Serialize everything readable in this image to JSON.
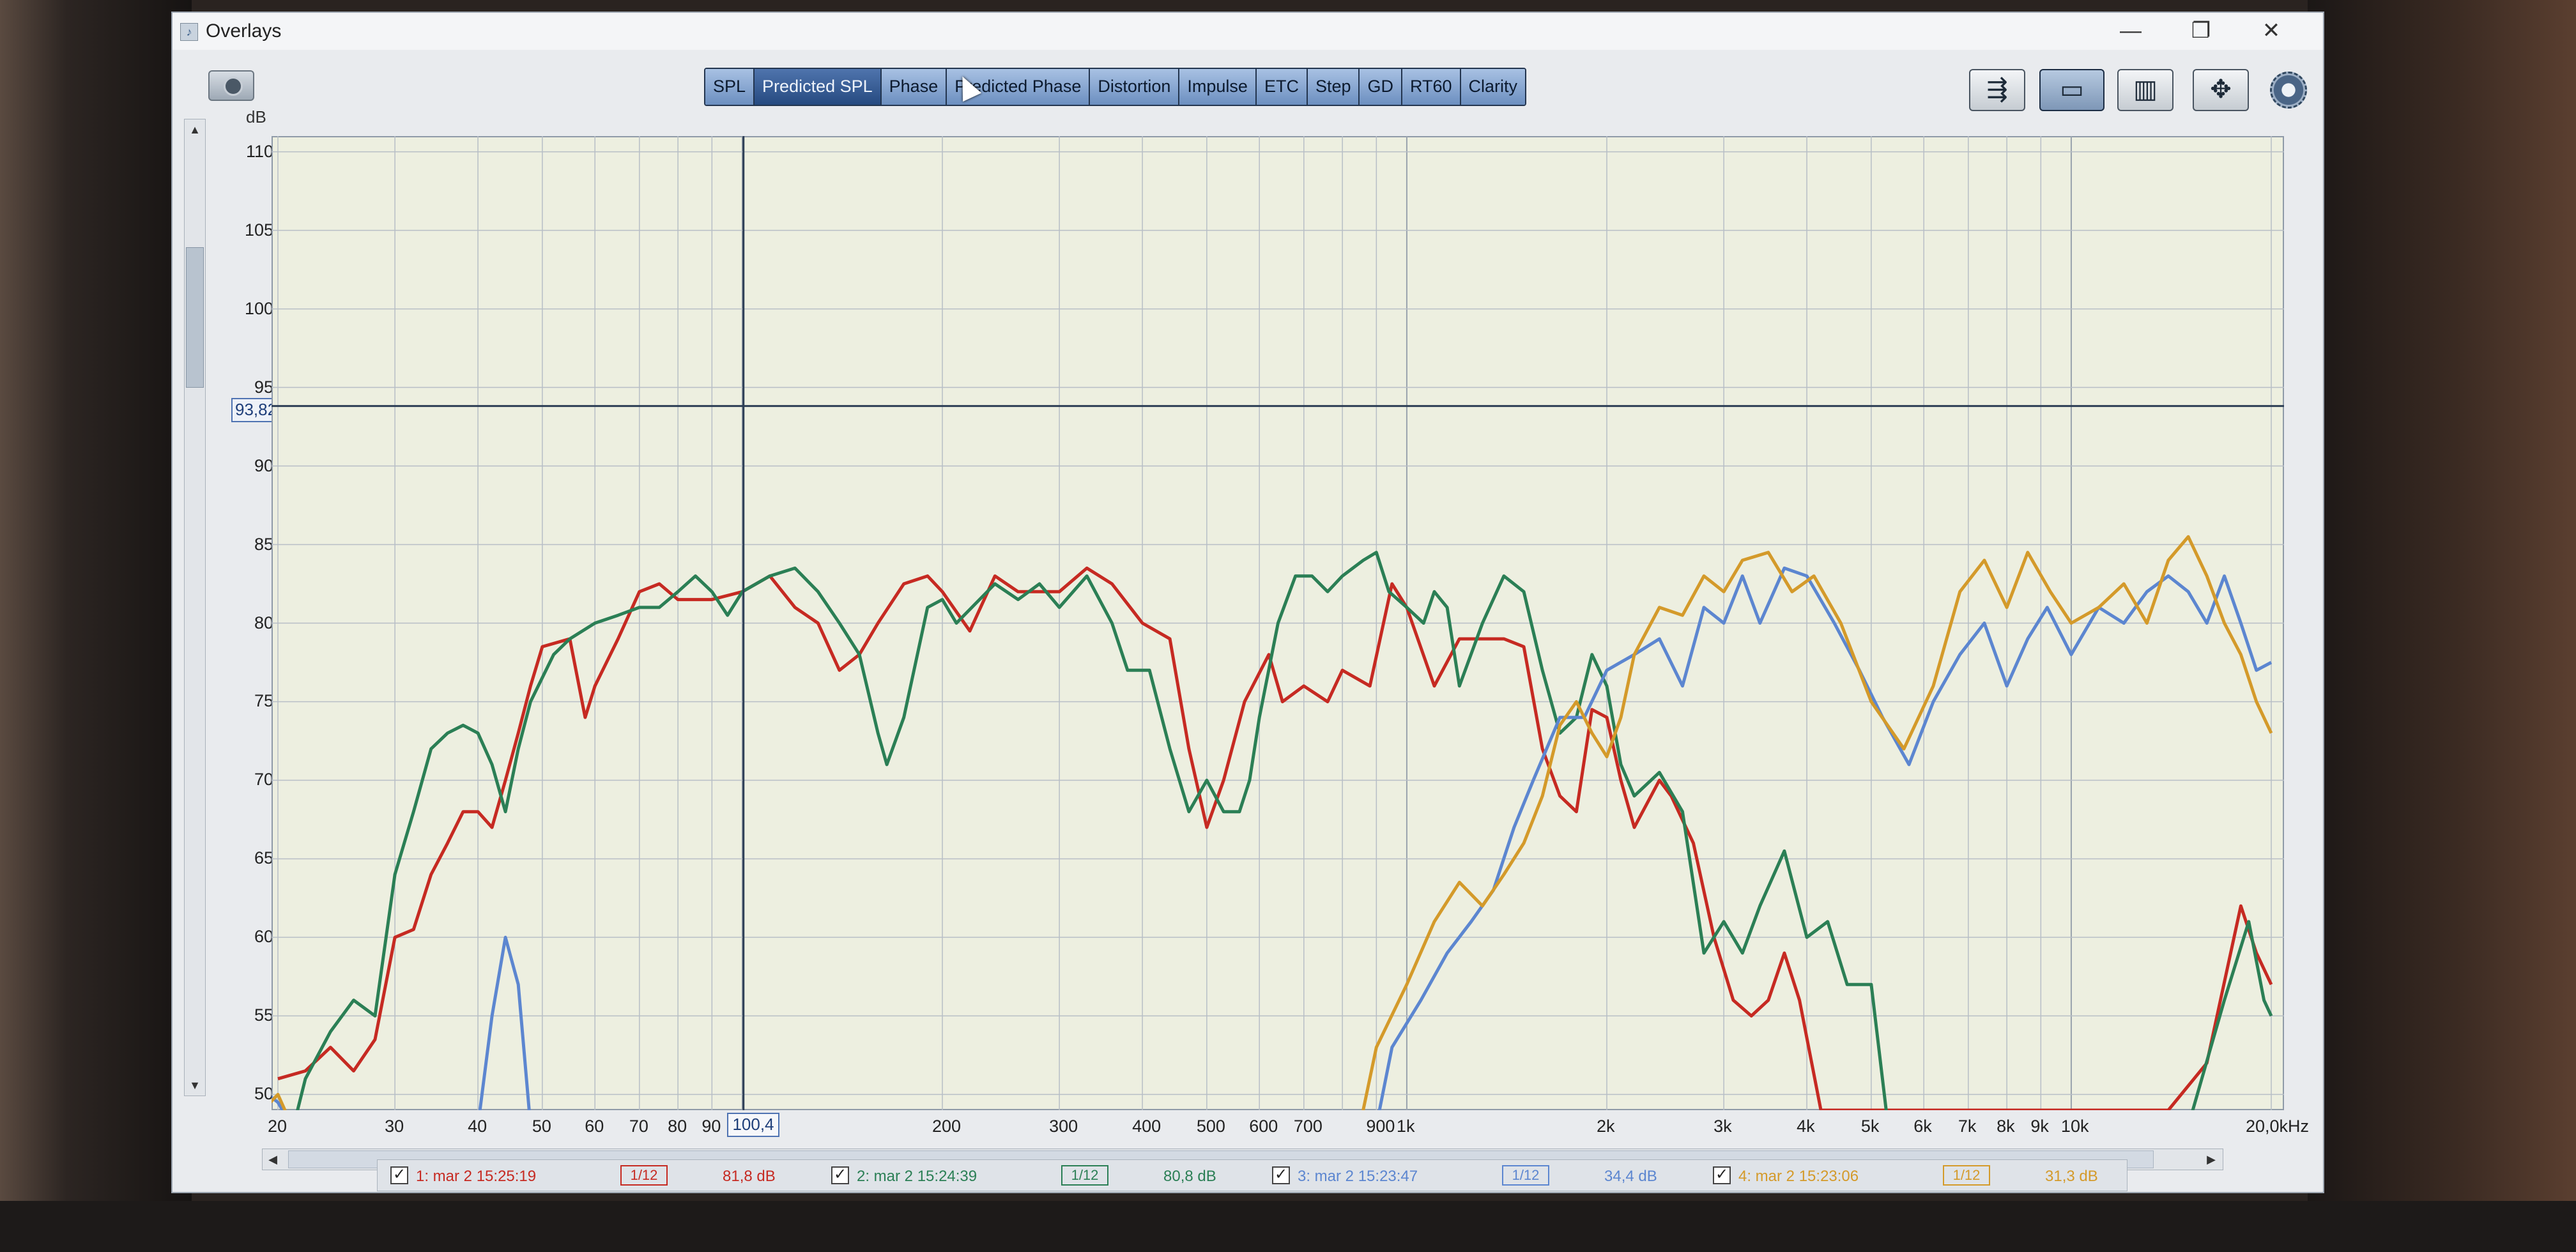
{
  "window": {
    "title": "Overlays",
    "controls": {
      "minimize": "—",
      "restore": "❐",
      "close": "✕"
    }
  },
  "tabs": [
    {
      "label": "SPL",
      "active": false
    },
    {
      "label": "Predicted SPL",
      "active": true
    },
    {
      "label": "Phase",
      "active": false
    },
    {
      "label": "Predicted Phase",
      "active": false
    },
    {
      "label": "Distortion",
      "active": false
    },
    {
      "label": "Impulse",
      "active": false
    },
    {
      "label": "ETC",
      "active": false
    },
    {
      "label": "Step",
      "active": false
    },
    {
      "label": "GD",
      "active": false
    },
    {
      "label": "RT60",
      "active": false
    },
    {
      "label": "Clarity",
      "active": false
    }
  ],
  "toolbar_icons": [
    "traces-icon",
    "zoom-window-icon",
    "grid-toggle-icon",
    "pan-arrows-icon",
    "gear-icon"
  ],
  "y_axis": {
    "unit": "dB",
    "ticks": [
      "110",
      "105",
      "100",
      "95",
      "90",
      "85",
      "80",
      "75",
      "70",
      "65",
      "60",
      "55",
      "50"
    ],
    "cursor_value": "93,82"
  },
  "x_axis": {
    "ticks": [
      "20",
      "30",
      "40",
      "50",
      "60",
      "70",
      "80",
      "90",
      "200",
      "300",
      "400",
      "500",
      "600",
      "700",
      "900",
      "1k",
      "2k",
      "3k",
      "4k",
      "5k",
      "6k",
      "7k",
      "8k",
      "9k",
      "10k",
      "20,0kHz"
    ],
    "cursor_value": "100,4"
  },
  "chart_data": {
    "type": "line",
    "title": "",
    "xlabel": "",
    "ylabel": "dB",
    "x_scale": "log",
    "xlim": [
      20,
      20000
    ],
    "ylim": [
      49,
      111
    ],
    "cursor": {
      "x": 100.4,
      "y": 93.82
    },
    "series": [
      {
        "name": "1: mar 2 15:25:19",
        "color": "#c62a22",
        "points": [
          [
            20,
            51
          ],
          [
            22,
            51.5
          ],
          [
            24,
            53
          ],
          [
            26,
            51.5
          ],
          [
            28,
            53.5
          ],
          [
            30,
            60
          ],
          [
            32,
            60.5
          ],
          [
            34,
            64
          ],
          [
            36,
            66
          ],
          [
            38,
            68
          ],
          [
            40,
            68
          ],
          [
            42,
            67
          ],
          [
            44,
            70
          ],
          [
            46,
            73
          ],
          [
            48,
            76
          ],
          [
            50,
            78.5
          ],
          [
            55,
            79
          ],
          [
            58,
            74
          ],
          [
            60,
            76
          ],
          [
            65,
            79
          ],
          [
            70,
            82
          ],
          [
            75,
            82.5
          ],
          [
            80,
            81.5
          ],
          [
            90,
            81.5
          ],
          [
            100,
            82
          ],
          [
            110,
            83
          ],
          [
            120,
            81
          ],
          [
            130,
            80
          ],
          [
            140,
            77
          ],
          [
            150,
            78
          ],
          [
            160,
            80
          ],
          [
            175,
            82.5
          ],
          [
            190,
            83
          ],
          [
            200,
            82
          ],
          [
            220,
            79.5
          ],
          [
            240,
            83
          ],
          [
            260,
            82
          ],
          [
            300,
            82
          ],
          [
            330,
            83.5
          ],
          [
            360,
            82.5
          ],
          [
            400,
            80
          ],
          [
            440,
            79
          ],
          [
            470,
            72
          ],
          [
            500,
            67
          ],
          [
            530,
            70
          ],
          [
            570,
            75
          ],
          [
            620,
            78
          ],
          [
            650,
            75
          ],
          [
            700,
            76
          ],
          [
            760,
            75
          ],
          [
            800,
            77
          ],
          [
            880,
            76
          ],
          [
            950,
            82.5
          ],
          [
            1000,
            81
          ],
          [
            1100,
            76
          ],
          [
            1200,
            79
          ],
          [
            1400,
            79
          ],
          [
            1500,
            78.5
          ],
          [
            1600,
            72
          ],
          [
            1700,
            69
          ],
          [
            1800,
            68
          ],
          [
            1900,
            74.5
          ],
          [
            2000,
            74
          ],
          [
            2100,
            70
          ],
          [
            2200,
            67
          ],
          [
            2400,
            70
          ],
          [
            2500,
            69
          ],
          [
            2700,
            66
          ],
          [
            2900,
            60
          ],
          [
            3100,
            56
          ],
          [
            3300,
            55
          ],
          [
            3500,
            56
          ],
          [
            3700,
            59
          ],
          [
            3900,
            56
          ],
          [
            4200,
            49
          ],
          [
            14000,
            49
          ],
          [
            16000,
            52
          ],
          [
            18000,
            62
          ],
          [
            19000,
            59
          ],
          [
            20000,
            57
          ]
        ]
      },
      {
        "name": "2: mar 2 15:24:39",
        "color": "#2b7f55",
        "points": [
          [
            20,
            44
          ],
          [
            22,
            51
          ],
          [
            24,
            54
          ],
          [
            26,
            56
          ],
          [
            28,
            55
          ],
          [
            30,
            64
          ],
          [
            32,
            68
          ],
          [
            34,
            72
          ],
          [
            36,
            73
          ],
          [
            38,
            73.5
          ],
          [
            40,
            73
          ],
          [
            42,
            71
          ],
          [
            44,
            68
          ],
          [
            46,
            72
          ],
          [
            48,
            75
          ],
          [
            52,
            78
          ],
          [
            55,
            79
          ],
          [
            60,
            80
          ],
          [
            65,
            80.5
          ],
          [
            70,
            81
          ],
          [
            75,
            81
          ],
          [
            80,
            82
          ],
          [
            85,
            83
          ],
          [
            90,
            82
          ],
          [
            95,
            80.5
          ],
          [
            100,
            82
          ],
          [
            110,
            83
          ],
          [
            120,
            83.5
          ],
          [
            130,
            82
          ],
          [
            140,
            80
          ],
          [
            150,
            78
          ],
          [
            160,
            73
          ],
          [
            165,
            71
          ],
          [
            175,
            74
          ],
          [
            190,
            81
          ],
          [
            200,
            81.5
          ],
          [
            210,
            80
          ],
          [
            240,
            82.5
          ],
          [
            260,
            81.5
          ],
          [
            280,
            82.5
          ],
          [
            300,
            81
          ],
          [
            330,
            83
          ],
          [
            360,
            80
          ],
          [
            380,
            77
          ],
          [
            410,
            77
          ],
          [
            440,
            72
          ],
          [
            470,
            68
          ],
          [
            500,
            70
          ],
          [
            530,
            68
          ],
          [
            560,
            68
          ],
          [
            580,
            70
          ],
          [
            600,
            74
          ],
          [
            640,
            80
          ],
          [
            680,
            83
          ],
          [
            720,
            83
          ],
          [
            760,
            82
          ],
          [
            800,
            83
          ],
          [
            860,
            84
          ],
          [
            900,
            84.5
          ],
          [
            940,
            82
          ],
          [
            1000,
            81
          ],
          [
            1060,
            80
          ],
          [
            1100,
            82
          ],
          [
            1150,
            81
          ],
          [
            1200,
            76
          ],
          [
            1300,
            80
          ],
          [
            1400,
            83
          ],
          [
            1500,
            82
          ],
          [
            1600,
            77
          ],
          [
            1700,
            73
          ],
          [
            1800,
            74
          ],
          [
            1900,
            78
          ],
          [
            2000,
            76
          ],
          [
            2100,
            71
          ],
          [
            2200,
            69
          ],
          [
            2400,
            70.5
          ],
          [
            2600,
            68
          ],
          [
            2800,
            59
          ],
          [
            3000,
            61
          ],
          [
            3200,
            59
          ],
          [
            3400,
            62
          ],
          [
            3700,
            65.5
          ],
          [
            4000,
            60
          ],
          [
            4300,
            61
          ],
          [
            4600,
            57
          ],
          [
            5000,
            57
          ],
          [
            5300,
            48
          ],
          [
            15000,
            48
          ],
          [
            17000,
            56
          ],
          [
            18500,
            61
          ],
          [
            19500,
            56
          ],
          [
            20000,
            55
          ]
        ]
      },
      {
        "name": "3: mar 2 15:23:47",
        "color": "#5c86d0",
        "points": [
          [
            18,
            51
          ],
          [
            20,
            49.5
          ],
          [
            21,
            48
          ],
          [
            40,
            48
          ],
          [
            42,
            55
          ],
          [
            44,
            60
          ],
          [
            46,
            57
          ],
          [
            48,
            48
          ],
          [
            900,
            48
          ],
          [
            950,
            53
          ],
          [
            1050,
            56
          ],
          [
            1150,
            59
          ],
          [
            1250,
            61
          ],
          [
            1350,
            63
          ],
          [
            1450,
            67
          ],
          [
            1550,
            70
          ],
          [
            1700,
            74
          ],
          [
            1850,
            74
          ],
          [
            2000,
            77
          ],
          [
            2200,
            78
          ],
          [
            2400,
            79
          ],
          [
            2600,
            76
          ],
          [
            2800,
            81
          ],
          [
            3000,
            80
          ],
          [
            3200,
            83
          ],
          [
            3400,
            80
          ],
          [
            3700,
            83.5
          ],
          [
            4000,
            83
          ],
          [
            4400,
            80
          ],
          [
            4800,
            77
          ],
          [
            5200,
            74
          ],
          [
            5700,
            71
          ],
          [
            6200,
            75
          ],
          [
            6800,
            78
          ],
          [
            7400,
            80
          ],
          [
            8000,
            76
          ],
          [
            8600,
            79
          ],
          [
            9200,
            81
          ],
          [
            10000,
            78
          ],
          [
            11000,
            81
          ],
          [
            12000,
            80
          ],
          [
            13000,
            82
          ],
          [
            14000,
            83
          ],
          [
            15000,
            82
          ],
          [
            16000,
            80
          ],
          [
            17000,
            83
          ],
          [
            18000,
            80
          ],
          [
            19000,
            77
          ],
          [
            20000,
            77.5
          ]
        ]
      },
      {
        "name": "4: mar 2 15:23:06",
        "color": "#d49a2a",
        "points": [
          [
            18,
            48
          ],
          [
            20,
            50
          ],
          [
            21,
            48
          ],
          [
            850,
            48
          ],
          [
            900,
            53
          ],
          [
            1000,
            57
          ],
          [
            1100,
            61
          ],
          [
            1200,
            63.5
          ],
          [
            1300,
            62
          ],
          [
            1400,
            64
          ],
          [
            1500,
            66
          ],
          [
            1600,
            69
          ],
          [
            1700,
            73.5
          ],
          [
            1800,
            75
          ],
          [
            1900,
            73
          ],
          [
            2000,
            71.5
          ],
          [
            2100,
            74
          ],
          [
            2200,
            78
          ],
          [
            2400,
            81
          ],
          [
            2600,
            80.5
          ],
          [
            2800,
            83
          ],
          [
            3000,
            82
          ],
          [
            3200,
            84
          ],
          [
            3500,
            84.5
          ],
          [
            3800,
            82
          ],
          [
            4100,
            83
          ],
          [
            4500,
            80
          ],
          [
            5000,
            75
          ],
          [
            5600,
            72
          ],
          [
            6200,
            76
          ],
          [
            6800,
            82
          ],
          [
            7400,
            84
          ],
          [
            8000,
            81
          ],
          [
            8600,
            84.5
          ],
          [
            9300,
            82
          ],
          [
            10000,
            80
          ],
          [
            11000,
            81
          ],
          [
            12000,
            82.5
          ],
          [
            13000,
            80
          ],
          [
            14000,
            84
          ],
          [
            15000,
            85.5
          ],
          [
            16000,
            83
          ],
          [
            17000,
            80
          ],
          [
            18000,
            78
          ],
          [
            19000,
            75
          ],
          [
            20000,
            73
          ]
        ]
      }
    ]
  },
  "legend": [
    {
      "name": "1: mar 2 15:25:19",
      "smoothing": "1/12",
      "value": "81,8 dB",
      "color": "#c62a22"
    },
    {
      "name": "2: mar 2 15:24:39",
      "smoothing": "1/12",
      "value": "80,8 dB",
      "color": "#2b7f55"
    },
    {
      "name": "3: mar 2 15:23:47",
      "smoothing": "1/12",
      "value": "34,4 dB",
      "color": "#5c86d0"
    },
    {
      "name": "4: mar 2 15:23:06",
      "smoothing": "1/12",
      "value": "31,3 dB",
      "color": "#d49a2a"
    }
  ]
}
